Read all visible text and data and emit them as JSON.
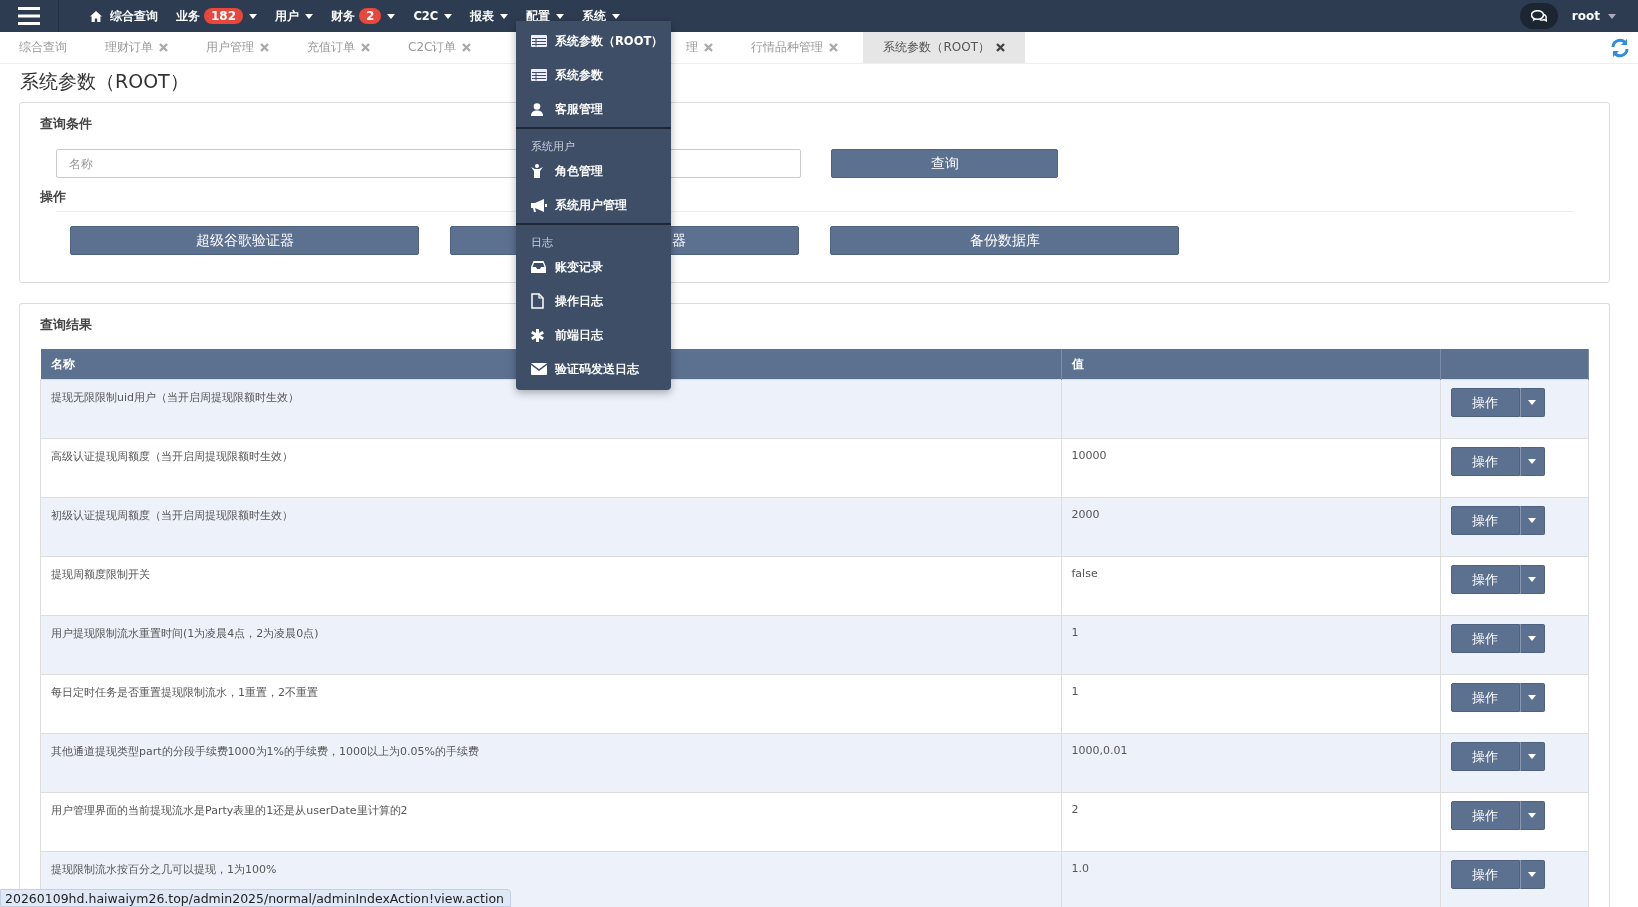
{
  "nav": {
    "items": [
      {
        "label": "综合查询",
        "caret": false,
        "home": true
      },
      {
        "label": "业务",
        "badge": "182",
        "caret": true,
        "home": false
      },
      {
        "label": "用户",
        "caret": true,
        "home": false
      },
      {
        "label": "财务",
        "badge": "2",
        "caret": true,
        "home": false
      },
      {
        "label": "C2C",
        "caret": true,
        "home": false
      },
      {
        "label": "报表",
        "caret": true,
        "home": false
      },
      {
        "label": "配置",
        "caret": true,
        "home": false
      },
      {
        "label": "系统",
        "caret": true,
        "home": false
      }
    ],
    "user": "root"
  },
  "tabs": [
    {
      "label": "综合查询",
      "closable": false,
      "selected": false
    },
    {
      "label": "理财订单",
      "closable": true,
      "selected": false
    },
    {
      "label": "用户管理",
      "closable": true,
      "selected": false
    },
    {
      "label": "充值订单",
      "closable": true,
      "selected": false
    },
    {
      "label": "C2C订单",
      "closable": true,
      "selected": false
    },
    {
      "label": "理",
      "closable": true,
      "selected": false
    },
    {
      "label": "行情品种管理",
      "closable": true,
      "selected": false
    },
    {
      "label": "系统参数（ROOT）",
      "closable": true,
      "selected": true
    }
  ],
  "page_title": "系统参数（ROOT）",
  "query": {
    "title": "查询条件",
    "placeholder": "名称",
    "button": "查询",
    "ops_title": "操作",
    "ops": [
      {
        "label": "超级谷歌验证器",
        "clipped": false
      },
      {
        "label": "器",
        "clipped": true
      },
      {
        "label": "备份数据库",
        "clipped": false
      }
    ]
  },
  "results": {
    "title": "查询结果",
    "columns": [
      "名称",
      "值"
    ],
    "rows": [
      {
        "name": "提现无限限制uid用户（当开启周提现限额时生效）",
        "action": "操作"
      },
      {
        "name": "高级认证提现周额度（当开启周提现限额时生效）",
        "value": "10000",
        "action": "操作"
      },
      {
        "name": "初级认证提现周额度（当开启周提现限额时生效）",
        "value": "2000",
        "action": "操作"
      },
      {
        "name": "提现周额度限制开关",
        "value": "false",
        "action": "操作"
      },
      {
        "name": "用户提现限制流水重置时间(1为凌晨4点，2为凌晨0点)",
        "value": "1",
        "action": "操作"
      },
      {
        "name": "每日定时任务是否重置提现限制流水，1重置，2不重置",
        "value": "1",
        "action": "操作"
      },
      {
        "name": "其他通道提现类型part的分段手续费1000为1%的手续费，1000以上为0.05%的手续费",
        "value": "1000,0.01",
        "action": "操作"
      },
      {
        "name": "用户管理界面的当前提现流水是Party表里的1还是从userDate里计算的2",
        "value": "2",
        "action": "操作"
      },
      {
        "name": "提现限制流水按百分之几可以提现，1为100%",
        "value": "1.0",
        "action": "操作"
      }
    ]
  },
  "menu": {
    "sections": [
      {
        "items": [
          "系统参数（ROOT）",
          "系统参数",
          "客服管理"
        ]
      },
      {
        "header": "系统用户",
        "items": [
          "角色管理",
          "系统用户管理"
        ]
      },
      {
        "header": "日志",
        "items": [
          "账变记录",
          "操作日志",
          "前端日志",
          "验证码发送日志"
        ]
      }
    ]
  },
  "status_bar": "20260109hd.haiwaiym26.top/admin2025/normal/adminIndexAction!view.action"
}
